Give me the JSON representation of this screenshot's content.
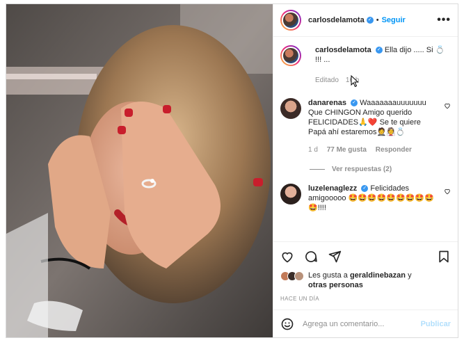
{
  "header": {
    "username": "carlosdelamota",
    "follow_label": "Seguir",
    "more_label": "•••"
  },
  "caption": {
    "username": "carlosdelamota",
    "text": "Ella dijo ..... Si 💍 !!! ...",
    "edited": "Editado",
    "time": "16 h"
  },
  "comments": [
    {
      "username": "danarenas",
      "text": "Waaaaaaauuuuuuu Que CHINGON Amigo querido FELICIDADES🙏❤️ Se te quiere Papá ahí estaremos🤵👰💍",
      "time": "1 d",
      "likes": "77 Me gusta",
      "reply": "Responder",
      "view_replies": "Ver respuestas (2)"
    },
    {
      "username": "luzelenaglezz",
      "text": "Felicidades amigooooo 🤩🤩🤩🤩🤩🤩🤩🤩🤩🤩!!!!"
    }
  ],
  "likes": {
    "prefix": "Les gusta a ",
    "user": "geraldinebazan",
    "suffix": " y",
    "others": "otras personas"
  },
  "time_ago": "HACE UN DÍA",
  "add_comment": {
    "placeholder": "Agrega un comentario...",
    "publish_label": "Publicar"
  },
  "colors": {
    "accent": "#0095f6",
    "verified": "#3897f0",
    "muted": "#8e8e8e",
    "border": "#dbdbdb"
  }
}
